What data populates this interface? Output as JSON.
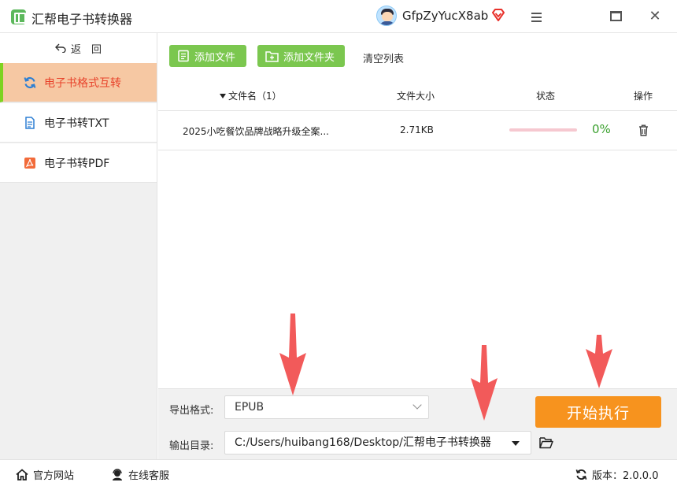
{
  "app": {
    "title": "汇帮电子书转换器"
  },
  "user": {
    "name": "GfpZyYucX8ab"
  },
  "sidebar": {
    "back_label": "返　回",
    "items": [
      {
        "label": "电子书格式互转",
        "icon": "refresh-icon",
        "active": true
      },
      {
        "label": "电子书转TXT",
        "icon": "document-icon",
        "active": false
      },
      {
        "label": "电子书转PDF",
        "icon": "pdf-icon",
        "active": false
      }
    ]
  },
  "toolbar": {
    "add_file": "添加文件",
    "add_folder": "添加文件夹",
    "clear_list": "清空列表"
  },
  "table": {
    "headers": {
      "filename": "文件名（1）",
      "size": "文件大小",
      "status": "状态",
      "action": "操作"
    },
    "rows": [
      {
        "filename": "2025小吃餐饮品牌战略升级全案...",
        "size": "2.71KB",
        "progress_percent": "0%"
      }
    ]
  },
  "settings": {
    "format_label": "导出格式:",
    "format_value": "EPUB",
    "dir_label": "输出目录:",
    "dir_value": "C:/Users/huibang168/Desktop/汇帮电子书转换器",
    "start_label": "开始执行"
  },
  "statusbar": {
    "website": "官方网站",
    "support": "在线客服",
    "version": "版本：2.0.0.0"
  },
  "colors": {
    "accent_green": "#7bc74f",
    "active_nav_bg": "#f6c8a3",
    "active_nav_text": "#e8432b",
    "start_button": "#f7931e",
    "annotation_arrow": "#f25a5a"
  }
}
